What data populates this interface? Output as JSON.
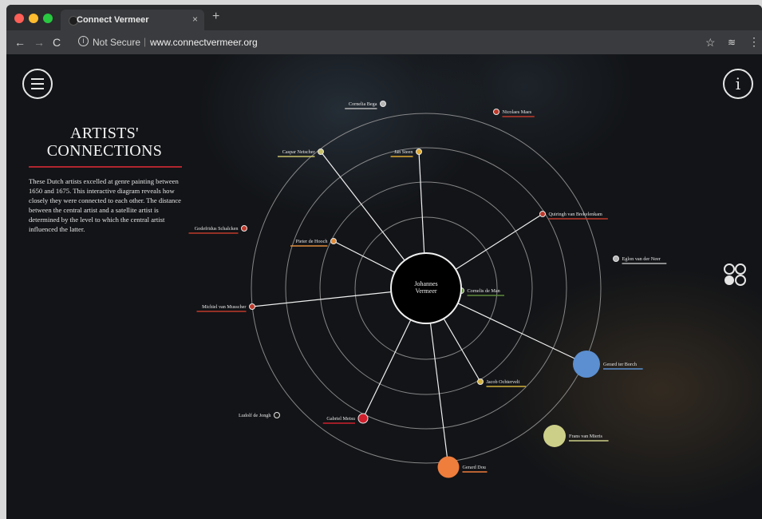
{
  "browser": {
    "tab_title": "Connect Vermeer",
    "tab_close": "×",
    "new_tab": "+",
    "nav": {
      "back": "←",
      "forward": "→",
      "reload": "C"
    },
    "security_label": "Not Secure",
    "separator": "|",
    "url": "www.connectvermeer.org",
    "bookmark_star": "☆",
    "extension_icon": "≋",
    "menu_dots": "⋮"
  },
  "page": {
    "heading_line1": "ARTISTS'",
    "heading_line2": "CONNECTIONS",
    "description": "These Dutch artists excelled at genre painting between 1650 and 1675. This interactive diagram reveals how closely they were connected to each other. The distance between the central artist and a satellite artist is determined by the level to which the central artist influenced the latter.",
    "info_icon_glyph": "i"
  },
  "diagram": {
    "central": {
      "name_line1": "Johannes",
      "name_line2": "Vermeer"
    },
    "artists": [
      {
        "name": "Cornelia Bega",
        "color": "#b5b5b5",
        "node": "small",
        "connected": false
      },
      {
        "name": "Nicolaes Maes",
        "color": "#c0392b",
        "node": "small",
        "connected": false
      },
      {
        "name": "Caspar Netscher",
        "color": "#c9c26a",
        "node": "small",
        "connected": true
      },
      {
        "name": "Jan Steen",
        "color": "#e0a92c",
        "node": "small",
        "connected": true
      },
      {
        "name": "Quiringh van Brekelenkam",
        "color": "#c0392b",
        "node": "small",
        "connected": true
      },
      {
        "name": "Godefridus Schalcken",
        "color": "#c0392b",
        "node": "small",
        "connected": false
      },
      {
        "name": "Pieter de Hooch",
        "color": "#e08c3a",
        "node": "small",
        "connected": true
      },
      {
        "name": "Eglon van der Neer",
        "color": "#b5b5b5",
        "node": "small",
        "connected": false
      },
      {
        "name": "Cornelis de Man",
        "color": "#5e8a3a",
        "node": "small",
        "connected": true
      },
      {
        "name": "Michiel van Musscher",
        "color": "#c0392b",
        "node": "small",
        "connected": true
      },
      {
        "name": "Gerard ter Borch",
        "color": "#5b8fd1",
        "node": "large",
        "connected": true
      },
      {
        "name": "Jacob Ochtervelt",
        "color": "#d4b13a",
        "node": "small",
        "connected": true
      },
      {
        "name": "Ludolf de Jongh",
        "color": "#1a1a1a",
        "node": "small",
        "connected": false
      },
      {
        "name": "Gabriel Metsu",
        "color": "#d0202e",
        "node": "medium",
        "connected": true
      },
      {
        "name": "Frans van Mieris",
        "color": "#cccf88",
        "node": "large",
        "connected": false
      },
      {
        "name": "Gerard Dou",
        "color": "#ef7d3c",
        "node": "large",
        "connected": true
      }
    ]
  },
  "colors": {
    "accent_red": "#b0262e",
    "ring": "#9a9a9a",
    "spoke": "#f0f0f0"
  }
}
